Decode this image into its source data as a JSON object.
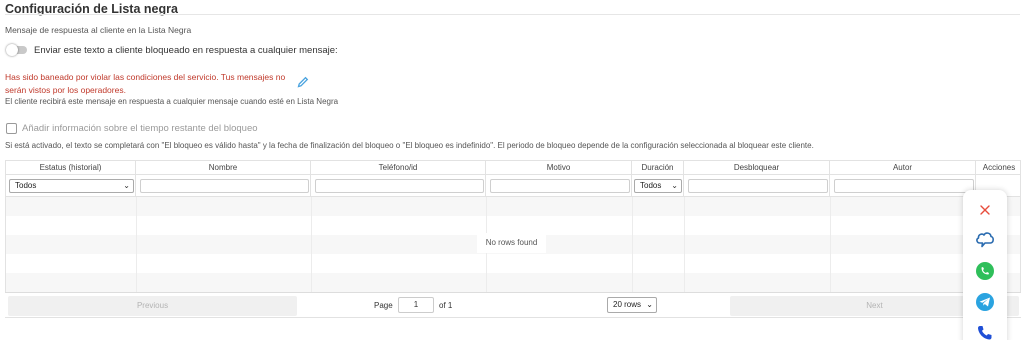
{
  "section": {
    "title": "Configuración de Lista negra",
    "response_label": "Mensaje de respuesta al cliente en la Lista Negra"
  },
  "toggle": {
    "label": "Enviar este texto a cliente bloqueado en respuesta a cualquier mensaje:",
    "enabled": false
  },
  "ban_message": {
    "text": "Has sido baneado por violar las condiciones del servicio. Tus mensajes no serán vistos por los operadores.",
    "hint": "El cliente recibirá este mensaje en respuesta a cualquier mensaje cuando esté en Lista Negra"
  },
  "checkbox": {
    "label": "Añadir información sobre el tiempo restante del bloqueo",
    "checked": false,
    "hint": "Si está activado, el texto se completará con \"El bloqueo es válido hasta\" y la fecha de finalización del bloqueo o \"El bloqueo es indefinido\". El periodo de bloqueo depende de la configuración seleccionada al bloquear este cliente."
  },
  "table": {
    "columns": [
      "Estatus (historial)",
      "Nombre",
      "Teléfono/id",
      "Motivo",
      "Duración",
      "Desbloquear",
      "Autor",
      "Acciones"
    ],
    "filters": {
      "status_select": "Todos",
      "duration_select": "Todos"
    },
    "empty_text": "No rows found"
  },
  "pagination": {
    "previous_label": "Previous",
    "next_label": "Next",
    "page_label": "Page",
    "page_value": "1",
    "of_label": "of 1",
    "rows_select": "20 rows"
  },
  "colors": {
    "ban_text": "#c0392b",
    "close_icon": "#e74c3c",
    "cloud_icon": "#2b6cb0",
    "whatsapp": "#2fbf5a",
    "telegram": "#2aa3e0",
    "phone": "#1f4fd6"
  },
  "floating_panel": {
    "icons": [
      "close-icon",
      "cloud-chat-icon",
      "whatsapp-icon",
      "telegram-icon",
      "phone-icon"
    ]
  }
}
